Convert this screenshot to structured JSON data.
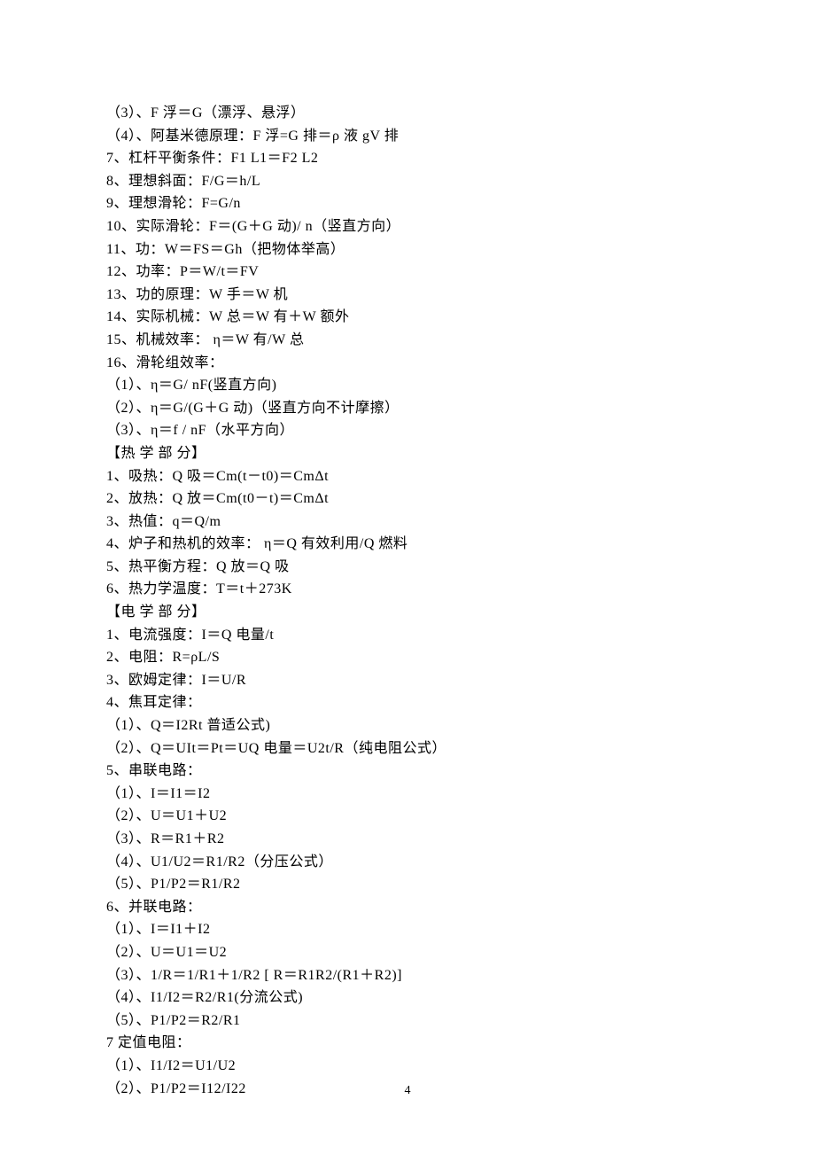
{
  "lines": [
    "（3）、F 浮＝G（漂浮、悬浮）",
    "（4）、阿基米德原理：F 浮=G 排＝ρ 液 gV 排",
    "7、杠杆平衡条件：F1 L1＝F2 L2",
    "8、理想斜面：F/G＝h/L",
    "9、理想滑轮：F=G/n",
    "10、实际滑轮：F＝(G＋G 动)/ n（竖直方向）",
    "11、功：W＝FS＝Gh（把物体举高）",
    "12、功率：P＝W/t＝FV",
    "13、功的原理：W 手＝W 机",
    "14、实际机械：W 总＝W 有＋W 额外",
    "15、机械效率： η＝W 有/W 总",
    "16、滑轮组效率：",
    "（1）、η＝G/ nF(竖直方向)",
    "（2）、η＝G/(G＋G 动)（竖直方向不计摩擦）",
    "（3）、η＝f / nF（水平方向）",
    "【热 学 部 分】",
    "1、吸热：Q 吸＝Cm(t－t0)＝CmΔt",
    "2、放热：Q 放＝Cm(t0－t)＝CmΔt",
    "3、热值：q＝Q/m",
    "4、炉子和热机的效率： η＝Q 有效利用/Q 燃料",
    "5、热平衡方程：Q 放＝Q 吸",
    "6、热力学温度：T＝t＋273K",
    "【电 学 部 分】",
    "1、电流强度：I＝Q 电量/t",
    "2、电阻：R=ρL/S",
    "3、欧姆定律：I＝U/R",
    "4、焦耳定律：",
    "（1）、Q＝I2Rt 普适公式)",
    "（2）、Q＝UIt＝Pt＝UQ 电量＝U2t/R（纯电阻公式）",
    "5、串联电路：",
    "（1）、I＝I1＝I2",
    "（2）、U＝U1＋U2",
    "（3）、R＝R1＋R2",
    "（4）、U1/U2＝R1/R2（分压公式）",
    "（5）、P1/P2＝R1/R2",
    "6、并联电路：",
    "（1）、I＝I1＋I2",
    "（2）、U＝U1＝U2",
    "（3）、1/R＝1/R1＋1/R2 [ R＝R1R2/(R1＋R2)]",
    "（4）、I1/I2＝R2/R1(分流公式)",
    "（5）、P1/P2＝R2/R1",
    "7 定值电阻：",
    "（1）、I1/I2＝U1/U2",
    "（2）、P1/P2＝I12/I22"
  ],
  "pageNumber": "4"
}
